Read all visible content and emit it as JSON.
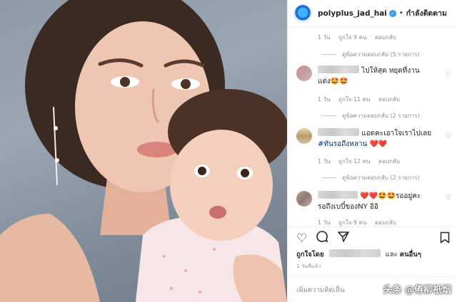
{
  "header": {
    "username": "polyplus_jad_hai",
    "verified_mark": "✓",
    "separator": "•",
    "follow_status": "กำลังติดตาม"
  },
  "threads": [
    {
      "meta": {
        "age": "1 วัน",
        "likes": "ถูกใจ 9 คน",
        "reply": "ตอบกลับ"
      },
      "view_replies": "ดูข้อความตอบกลับ (5 รายการ)"
    },
    {
      "comment_line1": "ไปให้สุด หยุดที่งาน",
      "comment_line2": "แต่ง🤩🤩",
      "meta": {
        "age": "1 วัน",
        "likes": "ถูกใจ 11 คน",
        "reply": "ตอบกลับ"
      },
      "view_replies": "ดูข้อความตอบกลับ (2 รายการ)"
    },
    {
      "comment_line1": "แอดคะเอาใจเราไปเลย",
      "hashtag": "#ทันรอถึงหลาน",
      "hearts": "❤️❤️",
      "meta": {
        "age": "1 วัน",
        "likes": "ถูกใจ 12 คน",
        "reply": "ตอบกลับ"
      },
      "view_replies": "ดูข้อความตอบกลับ (2 รายการ)"
    },
    {
      "emoji_prefix": "❤️❤️🤩🤩",
      "comment_line1_end": "รออยู่คะ",
      "comment_line2": "รอถึงเบบี๋ของNY อิอิ",
      "meta": {
        "age": "1 วัน",
        "likes": "ถูกใจ 9 คน",
        "reply": "ตอบกลับ"
      }
    }
  ],
  "actions": {
    "like_icon": "heart-outline-icon",
    "comment_icon": "comment-bubble-icon",
    "share_icon": "paper-plane-icon",
    "bookmark_icon": "bookmark-icon"
  },
  "likes_summary": {
    "prefix": "ถูกใจโดย",
    "middle": "และ",
    "others": "คนอื่นๆ"
  },
  "post_date": "1 วันที่แล้ว",
  "add_comment_placeholder": "เพิ่มความคิดเห็น",
  "watermark": "头条 @倦柳祇烟"
}
